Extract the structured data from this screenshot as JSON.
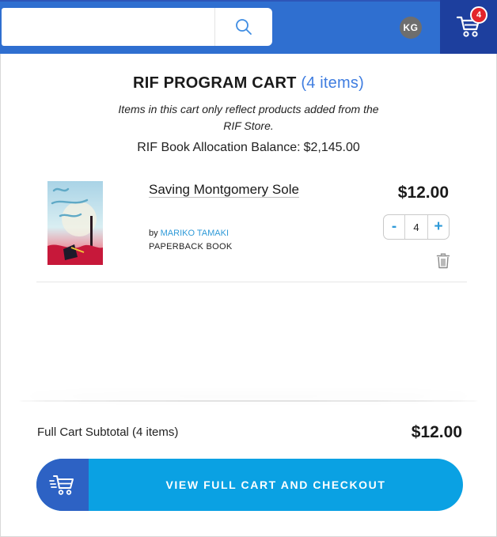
{
  "header": {
    "search": {
      "placeholder": "",
      "value": ""
    },
    "avatar_initials": "KG",
    "cart_badge": "4",
    "colors": {
      "bar": "#2f6fd0",
      "cart_bg": "#1d3f9e",
      "badge": "#e3242b"
    }
  },
  "cart": {
    "title": "RIF PROGRAM CART",
    "item_count_label": "(4 items)",
    "note": "Items in this cart only reflect products added from the RIF Store.",
    "balance_label": "RIF Book Allocation Balance:",
    "balance_value": "$2,145.00"
  },
  "items": [
    {
      "title": "Saving Montgomery Sole",
      "by_label": "by",
      "author": "MARIKO TAMAKI",
      "format": "PAPERBACK BOOK",
      "price": "$12.00",
      "quantity": "4",
      "minus_label": "-",
      "plus_label": "+"
    }
  ],
  "footer": {
    "subtotal_label": "Full Cart Subtotal (4 items)",
    "subtotal_value": "$12.00",
    "checkout_label": "VIEW FULL CART AND CHECKOUT",
    "colors": {
      "button": "#0aa1e3",
      "icon_box": "#2d62c4",
      "accent_text": "#2f9ad8"
    }
  },
  "icons": [
    "search-icon",
    "cart-icon",
    "trash-icon",
    "fast-cart-icon"
  ]
}
